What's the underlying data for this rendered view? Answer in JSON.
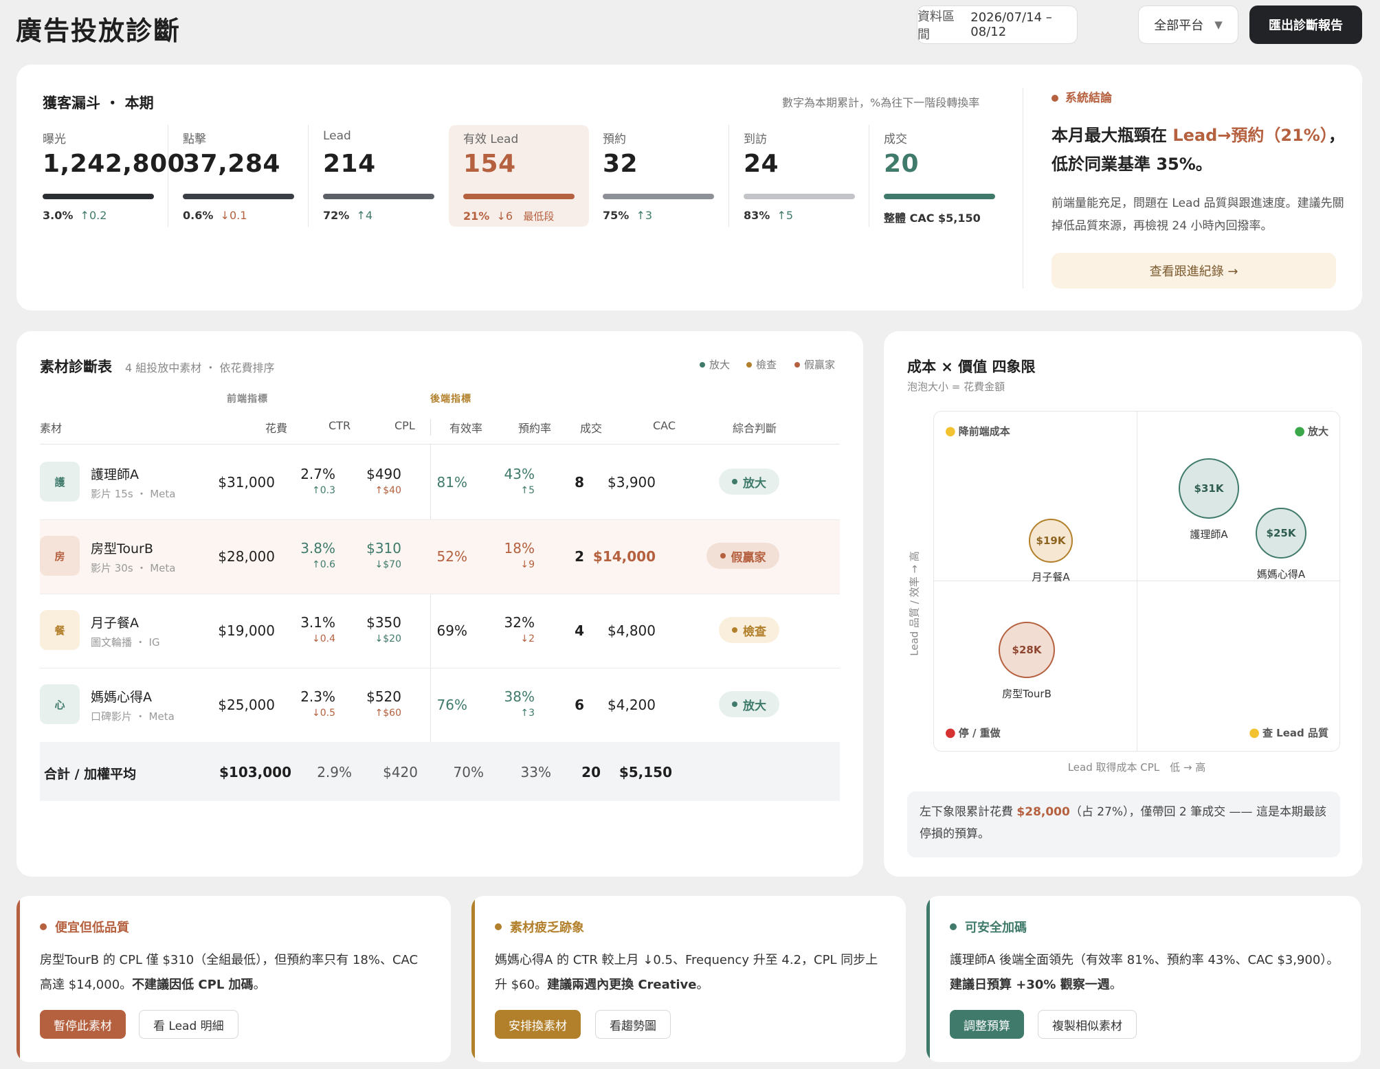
{
  "header": {
    "title": "廣告投放診斷",
    "date_label": "資料區間",
    "date_value": "2026/07/14 – 08/12",
    "platform": "全部平台",
    "platform_caret": "▼",
    "export": "匯出診斷報告"
  },
  "funnel": {
    "title": "獲客漏斗 ・ 本期",
    "note": "數字為本期累計，%為往下一階段轉換率",
    "stages": [
      {
        "label": "曝光",
        "value": "1,242,800",
        "rate": "3.0%",
        "delta": "↑0.2",
        "extra": ""
      },
      {
        "label": "點擊",
        "value": "37,284",
        "rate": "0.6%",
        "delta": "↓0.1",
        "extra": ""
      },
      {
        "label": "Lead",
        "value": "214",
        "rate": "72%",
        "delta": "↑4",
        "extra": ""
      },
      {
        "label": "有效 Lead",
        "value": "154",
        "rate": "21%",
        "delta": "↓6",
        "extra": "最低段"
      },
      {
        "label": "預約",
        "value": "32",
        "rate": "75%",
        "delta": "↑3",
        "extra": ""
      },
      {
        "label": "到訪",
        "value": "24",
        "rate": "83%",
        "delta": "↑5",
        "extra": ""
      },
      {
        "label": "成交",
        "value": "20",
        "rate": "整體 CAC $5,150",
        "delta": "",
        "extra": ""
      }
    ],
    "conclusion": {
      "head": "系統結論",
      "main_a": "本月最大瓶頸在 ",
      "main_b": "Lead→預約（21%）",
      "main_c": "，低於同業基準 35%。",
      "body": "前端量能充足，問題在 Lead 品質與跟進速度。建議先關掉低品質來源，再檢視 24 小時內回撥率。",
      "button": "查看跟進紀錄 →"
    }
  },
  "table": {
    "title": "素材診斷表",
    "subtitle": "4 組投放中素材 ・ 依花費排序",
    "legend": [
      "放大",
      "檢查",
      "假贏家"
    ],
    "group_front": "前端指標",
    "group_back": "後端指標",
    "headers": [
      "素材",
      "花費",
      "CTR",
      "CPL",
      "有效率",
      "預約率",
      "成交",
      "CAC",
      "綜合判斷"
    ],
    "rows": [
      {
        "icon": "護",
        "name": "護理師A",
        "sub": "影片 15s ・ Meta",
        "spend": "$31,000",
        "ctr": "2.7%",
        "ctr_d": "↑0.3",
        "cpl": "$490",
        "cpl_d": "↑$40",
        "eff": "81%",
        "book": "43%",
        "book_d": "↑5",
        "deals": "8",
        "cac": "$3,900",
        "verdict": "放大"
      },
      {
        "icon": "房",
        "name": "房型TourB",
        "sub": "影片 30s ・ Meta",
        "spend": "$28,000",
        "ctr": "3.8%",
        "ctr_d": "↑0.6",
        "cpl": "$310",
        "cpl_d": "↓$70",
        "eff": "52%",
        "book": "18%",
        "book_d": "↓9",
        "deals": "2",
        "cac": "$14,000",
        "verdict": "假贏家"
      },
      {
        "icon": "餐",
        "name": "月子餐A",
        "sub": "圖文輪播 ・ IG",
        "spend": "$19,000",
        "ctr": "3.1%",
        "ctr_d": "↓0.4",
        "cpl": "$350",
        "cpl_d": "↓$20",
        "eff": "69%",
        "book": "32%",
        "book_d": "↓2",
        "deals": "4",
        "cac": "$4,800",
        "verdict": "檢查"
      },
      {
        "icon": "心",
        "name": "媽媽心得A",
        "sub": "口碑影片 ・ Meta",
        "spend": "$25,000",
        "ctr": "2.3%",
        "ctr_d": "↓0.5",
        "cpl": "$520",
        "cpl_d": "↑$60",
        "eff": "76%",
        "book": "38%",
        "book_d": "↑3",
        "deals": "6",
        "cac": "$4,200",
        "verdict": "放大"
      }
    ],
    "total": {
      "label": "合計 / 加權平均",
      "spend": "$103,000",
      "ctr": "2.9%",
      "cpl": "$420",
      "eff": "70%",
      "book": "33%",
      "deals": "20",
      "cac": "$5,150"
    }
  },
  "quadrant": {
    "title": "成本 × 價值 四象限",
    "subtitle": "泡泡大小 = 花費金額",
    "q_tl": "降前端成本",
    "q_tr": "放大",
    "q_bl": "停 / 重做",
    "q_br": "查 Lead 品質",
    "y_axis": "Lead 品質 / 效率 → 高",
    "x_axis": "Lead 取得成本 CPL　低 → 高",
    "bubbles": [
      {
        "label": "$31K",
        "name": "護理師A"
      },
      {
        "label": "$25K",
        "name": "媽媽心得A"
      },
      {
        "label": "$19K",
        "name": "月子餐A"
      },
      {
        "label": "$28K",
        "name": "房型TourB"
      }
    ],
    "note_a": "左下象限累計花費 ",
    "note_b": "$28,000",
    "note_c": "（占 27%），僅帶回 2 筆成交 —— 這是本期最該停損的預算。"
  },
  "insights": [
    {
      "title": "便宜但低品質",
      "body_a": "房型TourB 的 CPL 僅 $310（全組最低），但預約率只有 18%、CAC 高達 $14,000。",
      "body_b": "不建議因低 CPL 加碼",
      "body_c": "。",
      "btn1": "暫停此素材",
      "btn2": "看 Lead 明細"
    },
    {
      "title": "素材疲乏跡象",
      "body_a": "媽媽心得A 的 CTR 較上月 ↓0.5、Frequency 升至 4.2，CPL 同步上升 $60。",
      "body_b": "建議兩週內更換 Creative",
      "body_c": "。",
      "btn1": "安排換素材",
      "btn2": "看趨勢圖"
    },
    {
      "title": "可安全加碼",
      "body_a": "護理師A 後端全面領先（有效率 81%、預約率 43%、CAC $3,900）。",
      "body_b": "建議日預算 +30% 觀察一週",
      "body_c": "。",
      "btn1": "調整預算",
      "btn2": "複製相似素材"
    }
  ],
  "colors": {
    "green": "#3f7a6b",
    "red": "#b5603f",
    "amber": "#b27f2a",
    "dark": "#222326"
  }
}
